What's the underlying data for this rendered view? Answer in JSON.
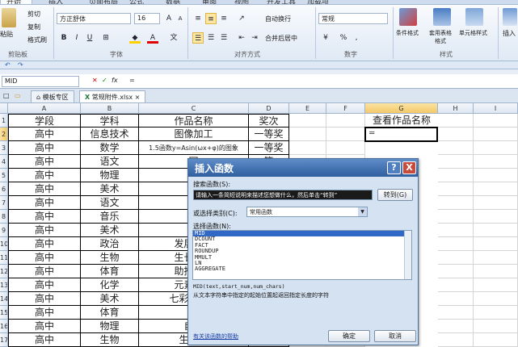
{
  "ribbon": {
    "tabs": [
      "开始",
      "插入",
      "页面布局",
      "公式",
      "数据",
      "审阅",
      "视图",
      "开发工具",
      "加载项"
    ],
    "clipboard": {
      "paste": "粘贴",
      "cut": "剪切",
      "copy": "复制",
      "format_painter": "格式刷",
      "label": "剪贴板"
    },
    "font": {
      "name": "方正舒体",
      "size": "16",
      "bold": "B",
      "italic": "I",
      "underline": "U",
      "label": "字体"
    },
    "alignment": {
      "wrap": "自动换行",
      "merge": "合并后居中",
      "label": "对齐方式"
    },
    "number": {
      "format": "常规",
      "label": "数字"
    },
    "styles": {
      "conditional": "条件格式",
      "table": "套用表格格式",
      "cell": "单元格样式",
      "label": "样式"
    },
    "cells": {
      "insert": "插入"
    }
  },
  "formula_bar": {
    "name_box": "MID",
    "fx": "fx",
    "content": "="
  },
  "doc_tabs": [
    "模板专区",
    "常规附件.xlsx"
  ],
  "columns": [
    "A",
    "B",
    "C",
    "D",
    "E",
    "F",
    "G",
    "H",
    "I"
  ],
  "rows": [
    {
      "num": "1",
      "a": "学段",
      "b": "学科",
      "c": "作品名称",
      "d": "奖次"
    },
    {
      "num": "2",
      "a": "高中",
      "b": "信息技术",
      "c": "图像加工",
      "d": "一等奖"
    },
    {
      "num": "3",
      "a": "高中",
      "b": "数学",
      "c": "1.5函数y=Asin(ωx+φ)的图象",
      "d": "一等奖"
    },
    {
      "num": "4",
      "a": "高中",
      "b": "语文",
      "c": "园",
      "d": "等"
    },
    {
      "num": "5",
      "a": "高中",
      "b": "物理",
      "c": "宇",
      "d": ""
    },
    {
      "num": "6",
      "a": "高中",
      "b": "美术",
      "c": "自",
      "d": ""
    },
    {
      "num": "7",
      "a": "高中",
      "b": "语文",
      "c": "直",
      "d": ""
    },
    {
      "num": "8",
      "a": "高中",
      "b": "音乐",
      "c": "文",
      "d": ""
    },
    {
      "num": "9",
      "a": "高中",
      "b": "美术",
      "c": "汉",
      "d": ""
    },
    {
      "num": "10",
      "a": "高中",
      "b": "政治",
      "c": "发展生产",
      "d": ""
    },
    {
      "num": "11",
      "a": "高中",
      "b": "生物",
      "c": "生长素的",
      "d": ""
    },
    {
      "num": "12",
      "a": "高中",
      "b": "体育",
      "c": "助推规定",
      "d": ""
    },
    {
      "num": "13",
      "a": "高中",
      "b": "化学",
      "c": "元素周期",
      "d": ""
    },
    {
      "num": "14",
      "a": "高中",
      "b": "美术",
      "c": "七彩霓裳到",
      "d": ""
    },
    {
      "num": "15",
      "a": "高中",
      "b": "体育",
      "c": "踏",
      "d": ""
    },
    {
      "num": "16",
      "a": "高中",
      "b": "物理",
      "c": "自由",
      "d": ""
    },
    {
      "num": "17",
      "a": "高中",
      "b": "生物",
      "c": "生命活",
      "d": ""
    }
  ],
  "g1": "查看作品名称",
  "g2": "=",
  "dialog": {
    "title": "插入函数",
    "help": "?",
    "close": "X",
    "search_label": "搜索函数(S):",
    "search_value": "请输入一条简短说明来描述您想做什么，然后单击“转到”",
    "go": "转到(G)",
    "category_label": "或选择类别(C):",
    "category_value": "常用函数",
    "list_label": "选择函数(N):",
    "functions": [
      "MID",
      "DCOUNT",
      "FACT",
      "ROUNDUP",
      "MMULT",
      "LN",
      "AGGREGATE"
    ],
    "signature": "MID(text,start_num,num_chars)",
    "description": "从文本字符串中指定的起始位置起返回指定长度的字符",
    "help_link": "有关该函数的帮助",
    "ok": "确定",
    "cancel": "取消"
  }
}
